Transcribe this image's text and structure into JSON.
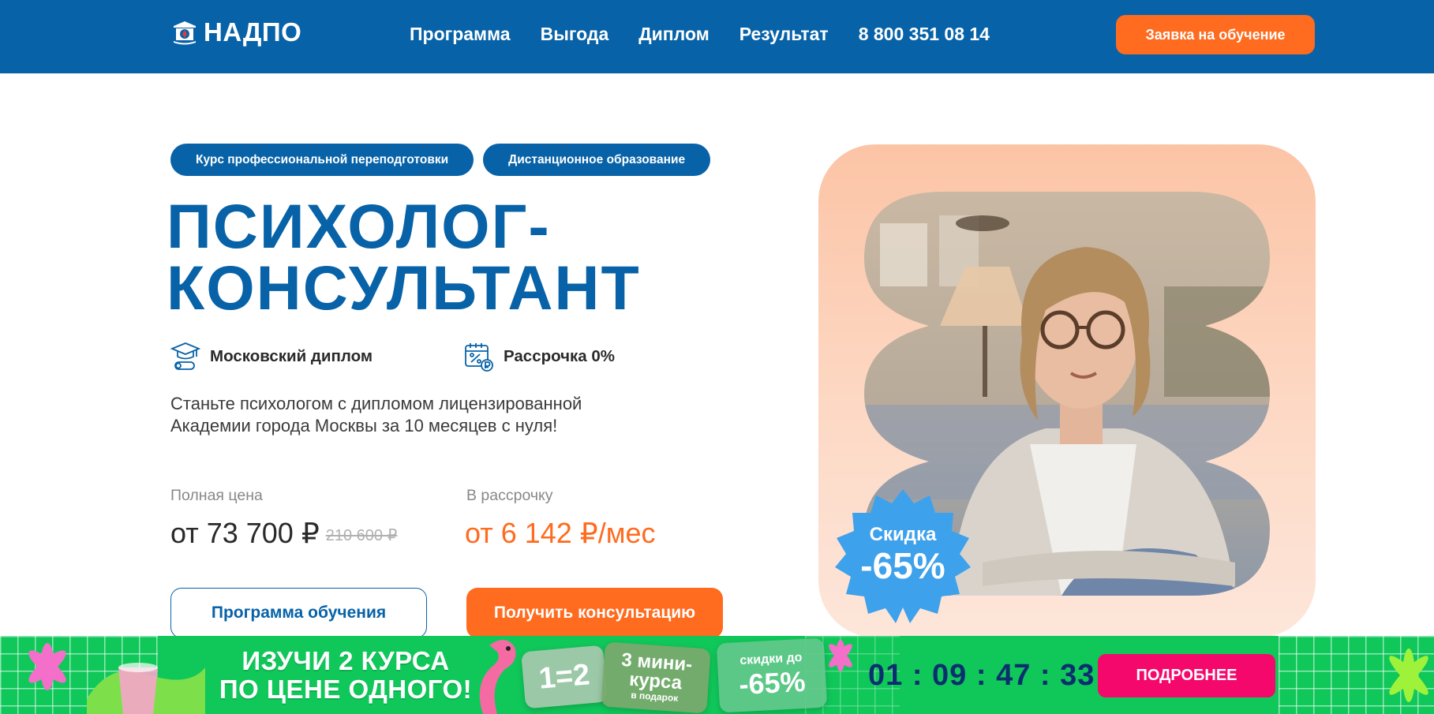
{
  "colors": {
    "primary": "#0762a8",
    "accent": "#ff6b1f",
    "promo_bg": "#10c75a",
    "promo_button": "#f5086c",
    "badge": "#3ea1ec"
  },
  "header": {
    "logo_text": "НАДПО",
    "logo_icon": "academy-emblem-icon",
    "nav": [
      "Программа",
      "Выгода",
      "Диплом",
      "Результат",
      "8 800 351 08 14"
    ],
    "cta_label": "Заявка на обучение"
  },
  "hero": {
    "tags": [
      "Курс профессиональной переподготовки",
      "Дистанционное образование"
    ],
    "title_line1": "ПСИХОЛОГ-",
    "title_line2": "КОНСУЛЬТАНТ",
    "features": [
      {
        "icon": "graduation-cap-diploma-icon",
        "label": "Московский диплом"
      },
      {
        "icon": "calendar-percent-ruble-icon",
        "label": "Рассрочка 0%"
      }
    ],
    "lead": "Станьте психологом с дипломом лицензированной Академии города Москвы за 10 месяцев с нуля!",
    "price": {
      "full_label": "Полная цена",
      "full_value": "от 73 700 ₽",
      "old_value": "210 600 ₽",
      "installment_label": "В рассрочку",
      "installment_value": "от 6 142 ₽/мес"
    },
    "button_program": "Программа обучения",
    "button_consult": "Получить консультацию",
    "badge_line1": "Скидка",
    "badge_line2": "-65%"
  },
  "promo": {
    "headline_line1": "ИЗУЧИ 2 КУРСА",
    "headline_line2": "ПО ЦЕНЕ ОДНОГО!",
    "tile1": "1=2",
    "tile2_line1": "3 мини-",
    "tile2_line2": "курса",
    "tile2_line3": "в подарок",
    "tile3_line1": "скидки до",
    "tile3_line2": "-65%",
    "timer": "01 : 09 : 47 : 33",
    "button": "ПОДРОБНЕЕ"
  }
}
